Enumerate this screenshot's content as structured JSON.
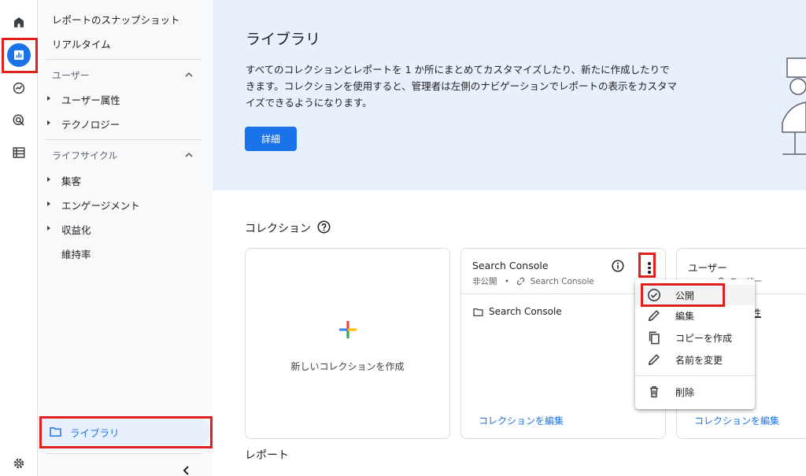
{
  "nav": {
    "snapshot": "レポートのスナップショット",
    "realtime": "リアルタイム",
    "user_header": "ユーザー",
    "user_attributes": "ユーザー属性",
    "technology": "テクノロジー",
    "lifecycle_header": "ライフサイクル",
    "acquisition": "集客",
    "engagement": "エンゲージメント",
    "monetization": "収益化",
    "retention": "維持率",
    "library": "ライブラリ"
  },
  "banner": {
    "title": "ライブラリ",
    "description": "すべてのコレクションとレポートを 1 か所にまとめてカスタマイズしたり、新たに作成したりできます。コレクションを使用すると、管理者は左側のナビゲーションでレポートの表示をカスタマイズできるようになります。",
    "details_button": "詳細"
  },
  "collections": {
    "title": "コレクション",
    "new_card_label": "新しいコレクションを作成",
    "cards": [
      {
        "title": "Search Console",
        "visibility": "非公開",
        "source": "Search Console",
        "item": "Search Console",
        "edit_link": "コレクションを編集"
      },
      {
        "title": "ユーザー",
        "source": "ユーザー",
        "item_fragment": "性",
        "edit_link": "コレクションを編集"
      }
    ]
  },
  "reports": {
    "title": "レポート"
  },
  "context_menu": {
    "items": [
      "公開",
      "編集",
      "コピーを作成",
      "名前を変更",
      "削除"
    ]
  },
  "colors": {
    "accent": "#1a73e8",
    "highlight": "#e0201c",
    "banner_bg": "#e8f0fe",
    "nav_bg": "#f8f9fa"
  },
  "icons": [
    "home-icon",
    "reports-icon",
    "explore-icon",
    "advertising-icon",
    "configure-icon",
    "settings-icon",
    "help-icon",
    "info-icon",
    "more-vert-icon",
    "folder-icon",
    "plus-icon",
    "check-circle-icon",
    "edit-icon",
    "copy-icon",
    "delete-icon",
    "chevron-up-icon",
    "chevron-left-icon",
    "link-icon"
  ]
}
